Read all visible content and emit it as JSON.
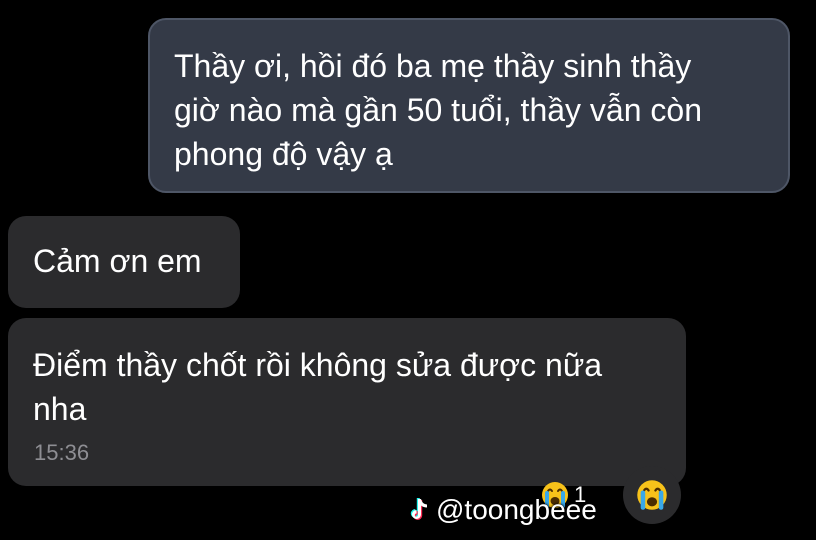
{
  "messages": [
    {
      "direction": "outgoing",
      "text": "Thầy ơi, hồi đó ba mẹ thầy sinh thầy\ngiờ nào mà gần 50 tuổi, thầy vẫn còn\nphong độ vậy ạ"
    },
    {
      "direction": "incoming",
      "text": "Cảm ơn em"
    },
    {
      "direction": "incoming",
      "text": "Điểm thầy chốt rồi không sửa được nữa\nnha",
      "time": "15:36",
      "reaction": {
        "icon": "crying-face-emoji",
        "count": "1"
      }
    }
  ],
  "reaction_button": {
    "icon": "crying-face-emoji"
  },
  "watermark": {
    "icon": "tiktok-logo-icon",
    "handle": "@toongbeee"
  },
  "colors": {
    "background": "#000000",
    "outgoing_bubble": "#343a47",
    "incoming_bubble": "#2b2b2d",
    "timestamp": "#8e8e93",
    "text": "#ffffff"
  }
}
